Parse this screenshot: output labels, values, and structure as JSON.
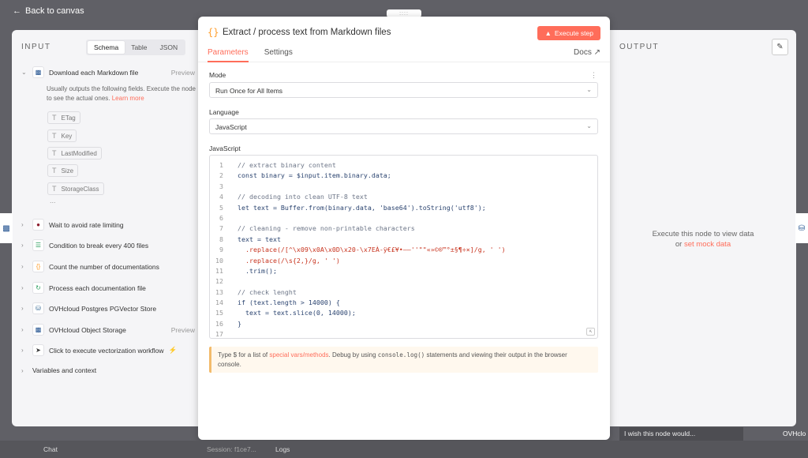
{
  "header": {
    "back_label": "Back to canvas",
    "drag_glyph": "::::"
  },
  "input_panel": {
    "title": "INPUT",
    "view_tabs": [
      "Schema",
      "Table",
      "JSON"
    ],
    "first_node": {
      "label": "Download each Markdown file",
      "preview": "Preview"
    },
    "hint_text": "Usually outputs the following fields. Execute the node to see the actual ones.",
    "hint_link": "Learn more",
    "fields": [
      "ETag",
      "Key",
      "LastModified",
      "Size",
      "StorageClass"
    ],
    "ellipsis": "...",
    "nodes": [
      {
        "label": "Wait to avoid rate limiting",
        "icon": "wait-icon",
        "preview": ""
      },
      {
        "label": "Condition to break every 400 files",
        "icon": "filter-icon",
        "preview": ""
      },
      {
        "label": "Count the number of documentations",
        "icon": "code-icon",
        "preview": ""
      },
      {
        "label": "Process each documentation file",
        "icon": "loop-icon",
        "preview": ""
      },
      {
        "label": "OVHcloud Postgres PGVector Store",
        "icon": "database-icon",
        "preview": ""
      },
      {
        "label": "OVHcloud Object Storage",
        "icon": "storage-icon",
        "preview": "Preview"
      },
      {
        "label": "Click to execute vectorization workflow",
        "icon": "cursor-icon",
        "preview": ""
      }
    ],
    "variables_label": "Variables and context"
  },
  "modal": {
    "title": "Extract / process text from Markdown files",
    "execute_label": "Execute step",
    "tabs": [
      "Parameters",
      "Settings"
    ],
    "docs_label": "Docs",
    "mode_label": "Mode",
    "mode_value": "Run Once for All Items",
    "language_label": "Language",
    "language_value": "JavaScript",
    "code_label": "JavaScript",
    "code_lines": [
      "  // extract binary content",
      "  const binary = $input.item.binary.data;",
      "",
      "  // decoding into clean UTF-8 text",
      "  let text = Buffer.from(binary.data, 'base64').toString('utf8');",
      "",
      "  // cleaning - remove non-printable characters",
      "  text = text",
      "    .replace(/[^\\x09\\x0A\\x0D\\x20-\\x7EÀ-ÿ€£¥•–—''\"\"«»©®™°±§¶÷×]/g, ' ')",
      "    .replace(/\\s{2,}/g, ' ')",
      "    .trim();",
      "",
      "  // check lenght",
      "  if (text.length > 14000) {",
      "    text = text.slice(0, 14000);",
      "  }",
      ""
    ],
    "notice": {
      "prefix": "Type $ for a list of ",
      "link": "special vars/methods",
      "middle": ". Debug by using ",
      "code": "console.log()",
      "suffix": " statements and viewing their output in the browser console."
    }
  },
  "output_panel": {
    "title": "OUTPUT",
    "message": "Execute this node to view data",
    "or": "or",
    "mock_link": "set mock data"
  },
  "bottom": {
    "chat": "Chat",
    "session": "Session: f1ce7...",
    "logs": "Logs",
    "wish": "I wish this node would...",
    "brand": "OVHclo"
  }
}
